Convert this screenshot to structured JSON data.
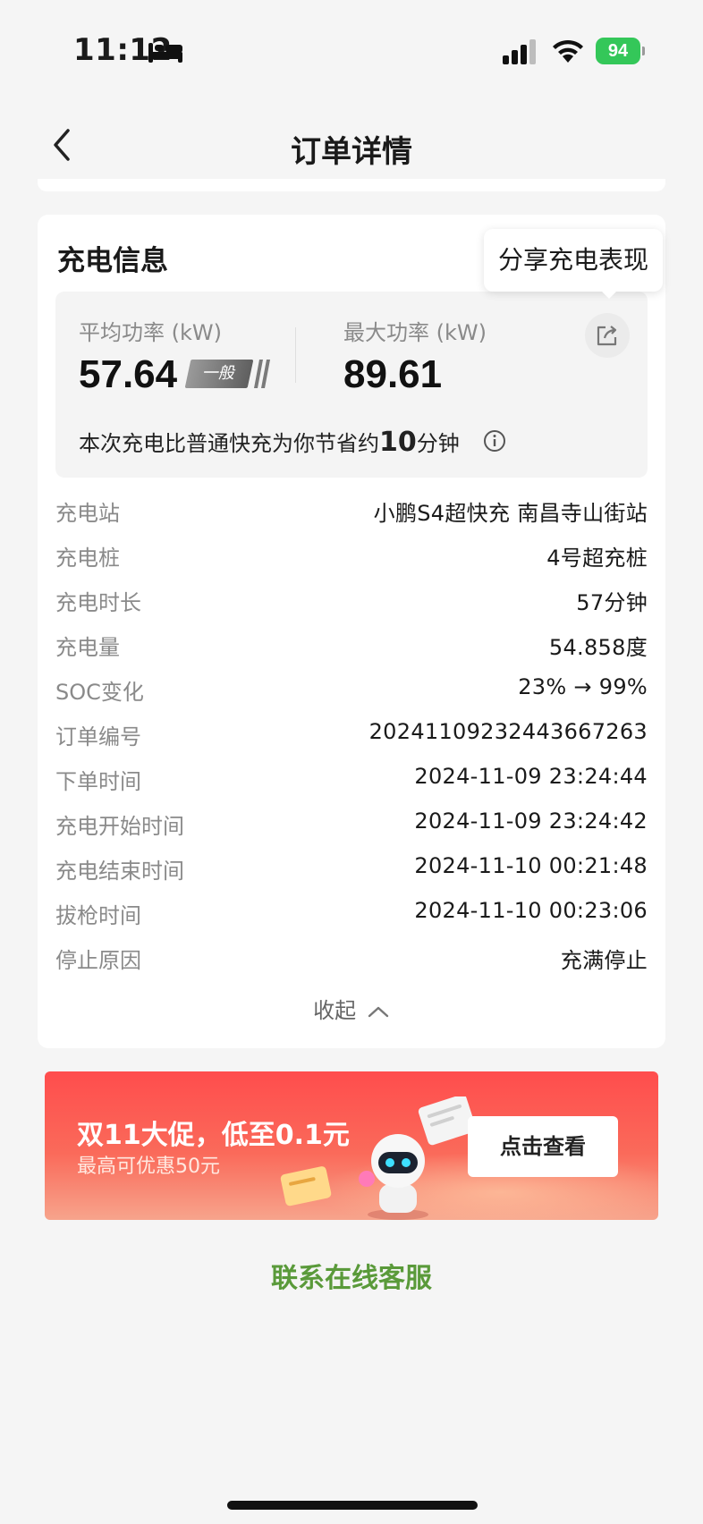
{
  "status_bar": {
    "time": "11:12",
    "battery": "94"
  },
  "nav": {
    "title": "订单详情"
  },
  "card": {
    "title": "充电信息",
    "tooltip": "分享充电表现",
    "avg_power_label": "平均功率 (kW)",
    "avg_power_value": "57.64",
    "level_badge": "一般",
    "max_power_label": "最大功率 (kW)",
    "max_power_value": "89.61",
    "save_prefix": "本次充电比普通快充为你节省约",
    "save_number": "10",
    "save_suffix": "分钟",
    "rows": [
      {
        "label": "充电站",
        "value": "小鹏S4超快充 南昌寺山街站"
      },
      {
        "label": "充电桩",
        "value": "4号超充桩"
      },
      {
        "label": "充电时长",
        "value": "57分钟"
      },
      {
        "label": "充电量",
        "value": "54.858度"
      },
      {
        "label": "SOC变化",
        "value": "23% → 99%"
      },
      {
        "label": "订单编号",
        "value": "20241109232443667263"
      },
      {
        "label": "下单时间",
        "value": "2024-11-09 23:24:44"
      },
      {
        "label": "充电开始时间",
        "value": "2024-11-09 23:24:42"
      },
      {
        "label": "充电结束时间",
        "value": "2024-11-10 00:21:48"
      },
      {
        "label": "拔枪时间",
        "value": "2024-11-10 00:23:06"
      },
      {
        "label": "停止原因",
        "value": "充满停止"
      }
    ],
    "collapse_label": "收起"
  },
  "banner": {
    "title": "双11大促，低至0.1元",
    "subtitle": "最高可优惠50元",
    "button": "点击查看"
  },
  "contact": "联系在线客服",
  "colors": {
    "accent_green": "#5a9a3a",
    "banner_red": "#ff4d4d",
    "battery_green": "#34c759"
  }
}
